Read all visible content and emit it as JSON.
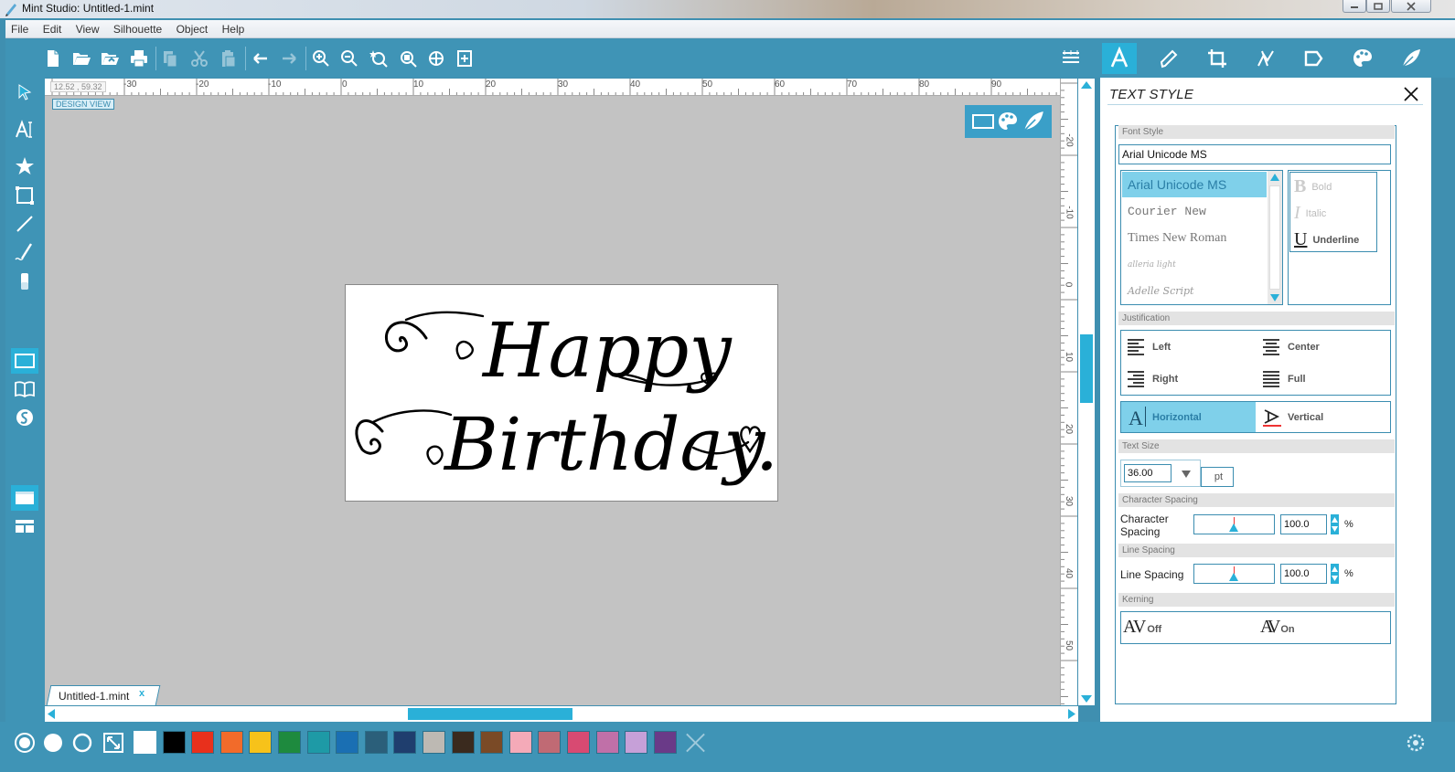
{
  "window": {
    "title": "Mint Studio: Untitled-1.mint"
  },
  "menu": [
    "File",
    "Edit",
    "View",
    "Silhouette",
    "Object",
    "Help"
  ],
  "toolbar": {
    "left_icons": [
      "new-file-icon",
      "open-folder-icon",
      "open-recent-icon",
      "print-icon",
      "copy-icon",
      "cut-icon",
      "paste-icon",
      "undo-icon",
      "redo-icon",
      "zoom-in-icon",
      "zoom-out-icon",
      "zoom-selection-icon",
      "zoom-fit-icon",
      "zoom-pan-icon",
      "fit-page-icon"
    ],
    "right_icons": [
      "align-icon",
      "text-style-icon",
      "pen-edit-icon",
      "crop-icon",
      "trace-icon",
      "replicate-icon",
      "fill-color-icon",
      "line-style-icon"
    ]
  },
  "canvas": {
    "coordinates": "12.52 , 59.32",
    "design_view_label": "DESIGN VIEW",
    "ruler_h_labels": [
      "-30",
      "-20",
      "-10",
      "0",
      "10",
      "20",
      "30",
      "40",
      "50",
      "60",
      "70",
      "80",
      "90"
    ],
    "ruler_v_labels": [
      "-20",
      "-10",
      "0",
      "10",
      "20",
      "30",
      "40",
      "50"
    ],
    "artwork_text_line1": "Happy",
    "artwork_text_line2": "Birthday."
  },
  "document_tab": {
    "name": "Untitled-1.mint",
    "close": "x"
  },
  "palette": {
    "colors": [
      "#ffffff",
      "#000000",
      "#e8301c",
      "#f26b2a",
      "#f7c21a",
      "#1e8a3e",
      "#1e9aa6",
      "#1a6fb3",
      "#2b5f7a",
      "#1f3e6e",
      "#bdb9b3",
      "#3a2a1e",
      "#7a4a26",
      "#f4aab8",
      "#c06a74",
      "#d84a72",
      "#c070a8",
      "#c6a0d8",
      "#6a3a88"
    ]
  },
  "text_style": {
    "title": "TEXT STYLE",
    "font_style_header": "Font Style",
    "font_input": "Arial Unicode MS",
    "fonts": [
      "Arial Unicode MS",
      "Courier New",
      "Times New Roman",
      "alleria light",
      "Adelle Script"
    ],
    "styles": {
      "bold": "Bold",
      "italic": "Italic",
      "underline": "Underline"
    },
    "justification_header": "Justification",
    "justify": {
      "left": "Left",
      "center": "Center",
      "right": "Right",
      "full": "Full"
    },
    "orientation": {
      "horizontal": "Horizontal",
      "vertical": "Vertical"
    },
    "text_size_header": "Text Size",
    "text_size_value": "36.00",
    "text_size_unit": "pt",
    "char_spacing_header": "Character Spacing",
    "char_spacing_label": "Character Spacing",
    "char_spacing_value": "100.0",
    "char_spacing_unit": "%",
    "line_spacing_header": "Line Spacing",
    "line_spacing_label": "Line Spacing",
    "line_spacing_value": "100.0",
    "line_spacing_unit": "%",
    "kerning_header": "Kerning",
    "kerning": {
      "off": "Off",
      "on": "On",
      "glyph": "AV"
    }
  },
  "colors": {
    "accent": "#2ab0d8",
    "panel": "#3f94b6",
    "canvas": "#c3c3c3"
  }
}
